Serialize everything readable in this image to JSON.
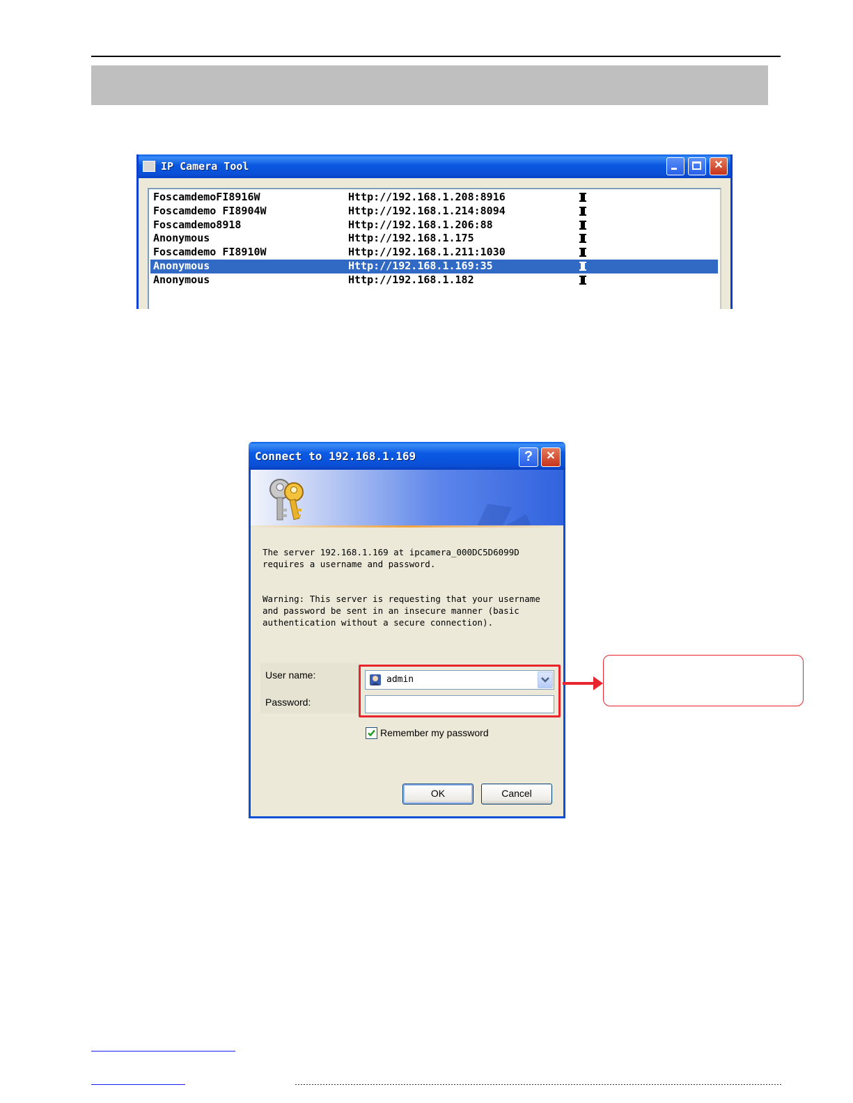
{
  "ip_camera_tool": {
    "title": "IP Camera Tool",
    "cameras": [
      {
        "name": "FoscamdemoFI8916W",
        "url": "Http://192.168.1.208:8916",
        "selected": false
      },
      {
        "name": "Foscamdemo FI8904W",
        "url": "Http://192.168.1.214:8094",
        "selected": false
      },
      {
        "name": "Foscamdemo8918",
        "url": "Http://192.168.1.206:88",
        "selected": false
      },
      {
        "name": "Anonymous",
        "url": "Http://192.168.1.175",
        "selected": false
      },
      {
        "name": "Foscamdemo FI8910W",
        "url": "Http://192.168.1.211:1030",
        "selected": false
      },
      {
        "name": "Anonymous",
        "url": "Http://192.168.1.169:35",
        "selected": true
      },
      {
        "name": "Anonymous",
        "url": "Http://192.168.1.182",
        "selected": false
      }
    ],
    "selected_color": "#316ac5"
  },
  "connect_dialog": {
    "title": "Connect to 192.168.1.169",
    "help_glyph": "?",
    "close_glyph": "✕",
    "message": "The server 192.168.1.169 at ipcamera_000DC5D6099D requires a username and password.",
    "warning": "Warning: This server is requesting that your username and password be sent in an insecure manner (basic authentication without a secure connection).",
    "user_label": "User name:",
    "user_value": "admin",
    "password_label": "Password:",
    "password_value": "",
    "remember_label": "Remember my password",
    "remember_checked": true,
    "ok_label": "OK",
    "cancel_label": "Cancel"
  },
  "colors": {
    "highlight_red": "#e8242e",
    "xp_blue": "#0a4fd6",
    "dialog_bg": "#ece9d8"
  }
}
